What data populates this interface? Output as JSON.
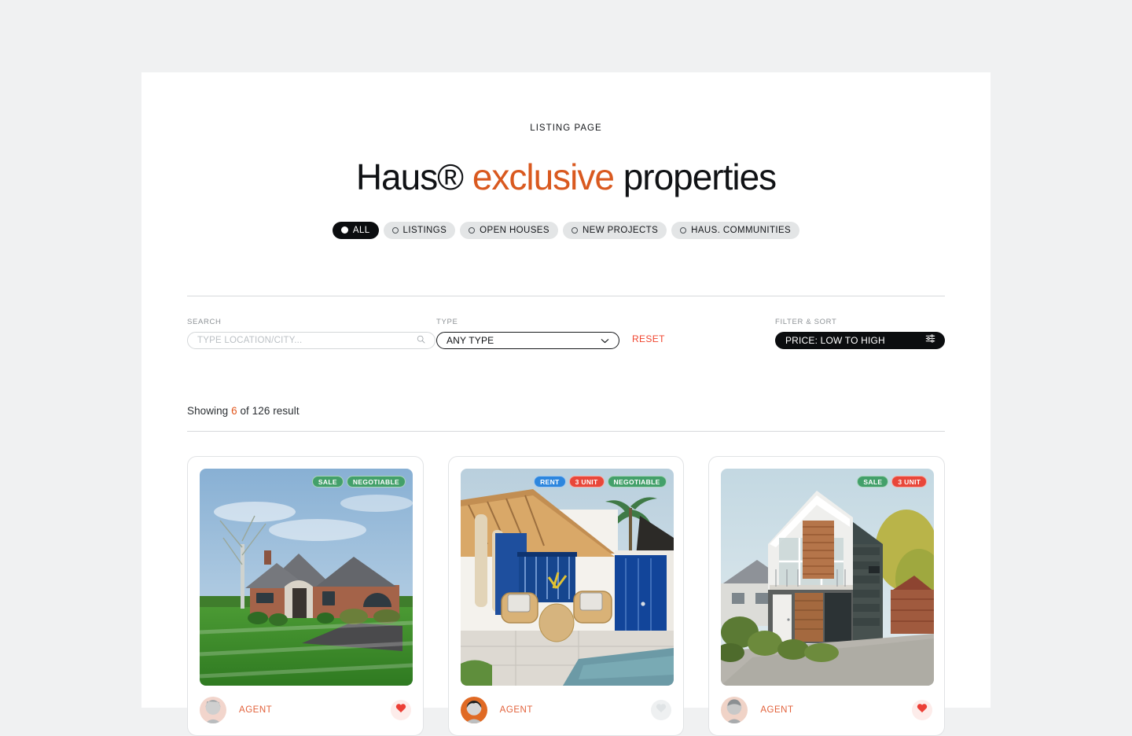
{
  "header": {
    "eyebrow": "LISTING PAGE",
    "title_part1": "Haus® ",
    "title_accent": "exclusive",
    "title_part2": " properties",
    "accent_color": "#d9591f"
  },
  "category_chips": [
    {
      "label": "ALL",
      "active": true
    },
    {
      "label": "LISTINGS",
      "active": false
    },
    {
      "label": "OPEN HOUSES",
      "active": false
    },
    {
      "label": "NEW PROJECTS",
      "active": false
    },
    {
      "label": "HAUS. COMMUNITIES",
      "active": false
    }
  ],
  "filters": {
    "search_label": "SEARCH",
    "search_value": "",
    "search_placeholder": "TYPE LOCATION/CITY...",
    "search_icon": "search-icon",
    "type_label": "TYPE",
    "type_value": "ANY TYPE",
    "type_icon": "chevron-down-icon",
    "reset_label": "RESET",
    "reset_color": "#f0442e",
    "sort_label": "FILTER & SORT",
    "sort_value": "PRICE: LOW TO HIGH",
    "sort_icon": "sliders-icon"
  },
  "results": {
    "prefix": "Showing ",
    "count": "6",
    "suffix": " of 126 result",
    "count_color": "#e2581f"
  },
  "cards": [
    {
      "image_alt": "brick-ranch-house-with-green-lawn",
      "badges": [
        {
          "label": "SALE",
          "color": "green"
        },
        {
          "label": "NEGOTIABLE",
          "color": "green"
        }
      ],
      "agent_label": "AGENT",
      "avatar_alt": "agent-avatar-blonde-woman",
      "favorited": true
    },
    {
      "image_alt": "white-villa-with-blue-doors-and-pool",
      "badges": [
        {
          "label": "RENT",
          "color": "blue"
        },
        {
          "label": "3 UNIT",
          "color": "red"
        },
        {
          "label": "NEGOTIABLE",
          "color": "green"
        }
      ],
      "agent_label": "AGENT",
      "avatar_alt": "agent-avatar-dark-hair",
      "favorited": false
    },
    {
      "image_alt": "modern-two-story-timber-and-slate-house",
      "badges": [
        {
          "label": "SALE",
          "color": "green"
        },
        {
          "label": "3 UNIT",
          "color": "red"
        }
      ],
      "agent_label": "AGENT",
      "avatar_alt": "agent-avatar-older-man",
      "favorited": true
    }
  ],
  "colors": {
    "page_background": "#f0f1f2",
    "surface": "#ffffff",
    "ink": "#0b0d0f",
    "badge_green": "#43a06a",
    "badge_red": "#e8473a",
    "badge_blue": "#2d86de"
  }
}
